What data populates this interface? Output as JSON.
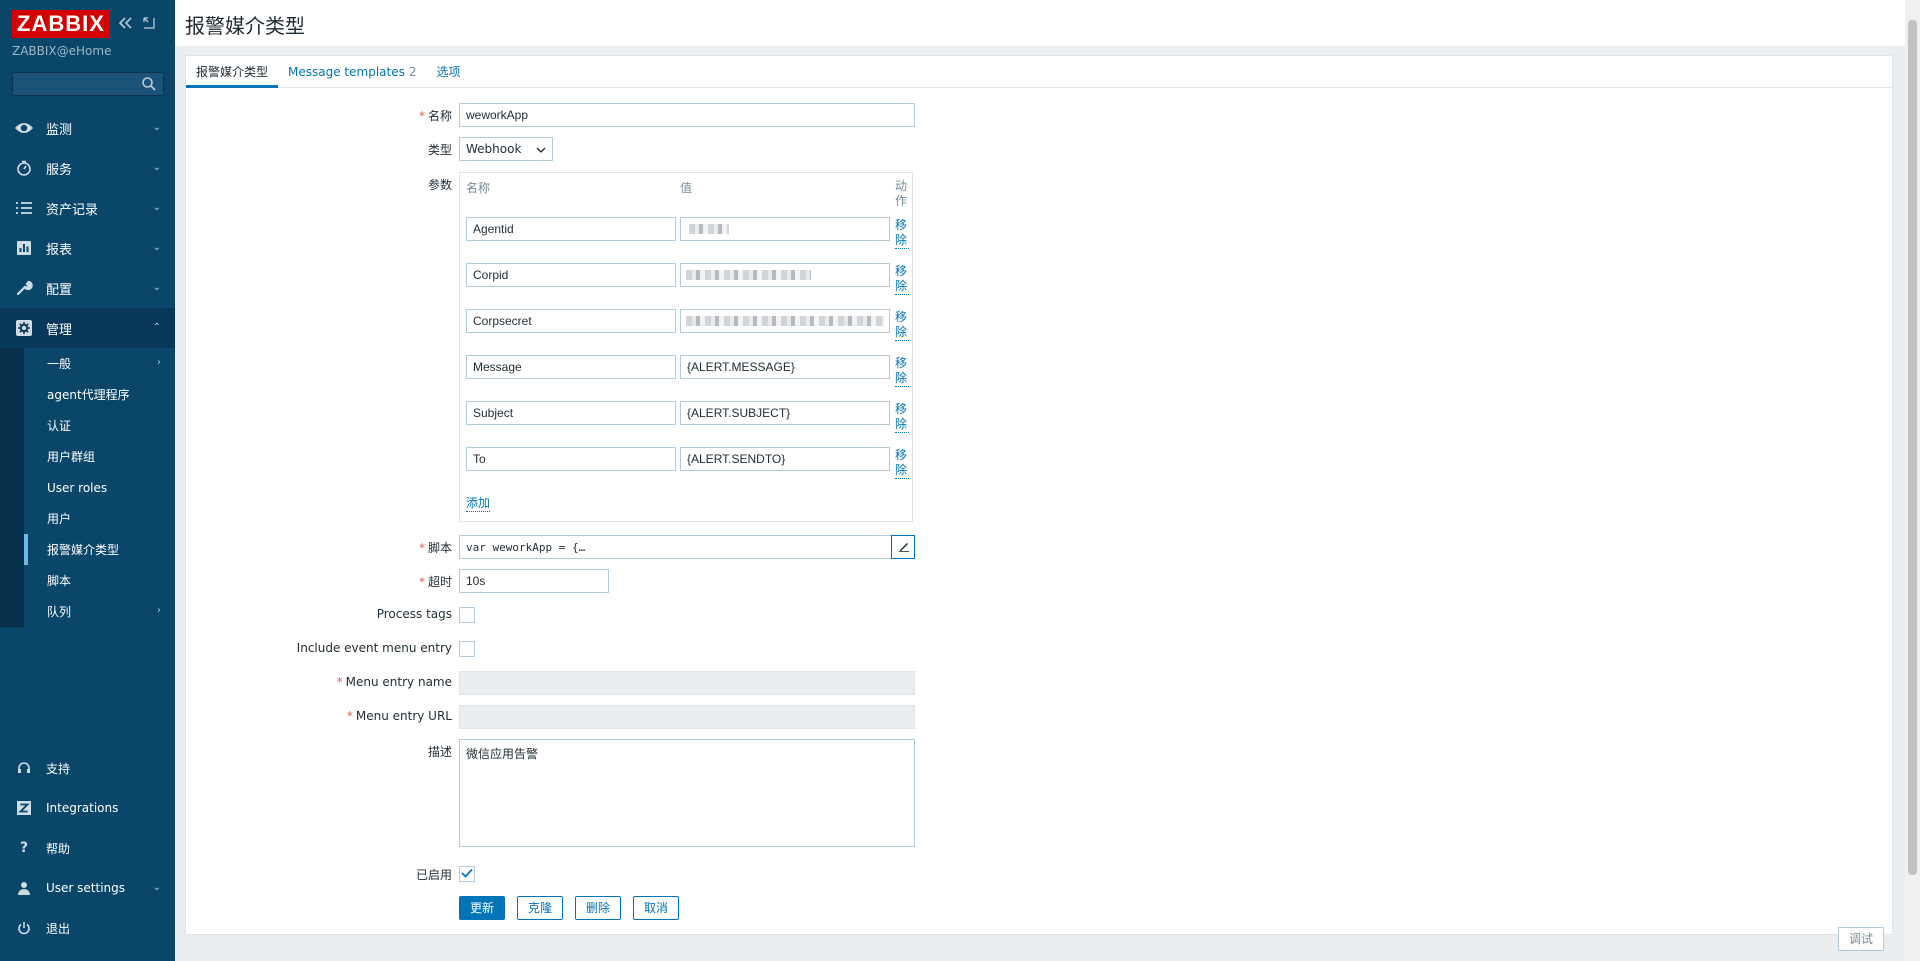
{
  "sidebar": {
    "logo": "ZABBIX",
    "server_name": "ZABBIX@eHome",
    "search_placeholder": "",
    "menu": [
      {
        "label": "监测",
        "icon": "eye-icon"
      },
      {
        "label": "服务",
        "icon": "clock-icon"
      },
      {
        "label": "资产记录",
        "icon": "list-icon"
      },
      {
        "label": "报表",
        "icon": "bar-chart-icon"
      },
      {
        "label": "配置",
        "icon": "wrench-icon"
      },
      {
        "label": "管理",
        "icon": "gear-icon"
      }
    ],
    "admin_submenu": [
      "一般",
      "agent代理程序",
      "认证",
      "用户群组",
      "User roles",
      "用户",
      "报警媒介类型",
      "脚本",
      "队列"
    ],
    "bottom": [
      {
        "label": "支持",
        "icon": "headset-icon"
      },
      {
        "label": "Integrations",
        "icon": "z-icon"
      },
      {
        "label": "帮助",
        "icon": "question-icon"
      },
      {
        "label": "User settings",
        "icon": "user-icon"
      },
      {
        "label": "退出",
        "icon": "power-icon"
      }
    ]
  },
  "header": {
    "title": "报警媒介类型"
  },
  "tabs": [
    {
      "label": "报警媒介类型",
      "count": ""
    },
    {
      "label": "Message templates",
      "count": "2"
    },
    {
      "label": "选项",
      "count": ""
    }
  ],
  "form": {
    "name_label": "名称",
    "name_value": "weworkApp",
    "type_label": "类型",
    "type_value": "Webhook",
    "params_label": "参数",
    "params_header": {
      "name": "名称",
      "value": "值",
      "action": "动作"
    },
    "params": [
      {
        "name": "Agentid",
        "value": ""
      },
      {
        "name": "Corpid",
        "value": ""
      },
      {
        "name": "Corpsecret",
        "value": ""
      },
      {
        "name": "Message",
        "value": "{ALERT.MESSAGE}"
      },
      {
        "name": "Subject",
        "value": "{ALERT.SUBJECT}"
      },
      {
        "name": "To",
        "value": "{ALERT.SENDTO}"
      }
    ],
    "remove_label": "移除",
    "add_label": "添加",
    "script_label": "脚本",
    "script_value": "var weworkApp = {…",
    "timeout_label": "超时",
    "timeout_value": "10s",
    "process_tags_label": "Process tags",
    "event_menu_label": "Include event menu entry",
    "menu_entry_name_label": "Menu entry name",
    "menu_entry_url_label": "Menu entry URL",
    "description_label": "描述",
    "description_value": "微信应用告警",
    "enabled_label": "已启用",
    "enabled": true
  },
  "buttons": {
    "update": "更新",
    "clone": "克隆",
    "delete": "删除",
    "cancel": "取消",
    "debug": "调试"
  },
  "colors": {
    "sidebar_bg": "#0a466a",
    "accent": "#0275b8",
    "logo_red": "#d40000",
    "required": "#e45959"
  }
}
